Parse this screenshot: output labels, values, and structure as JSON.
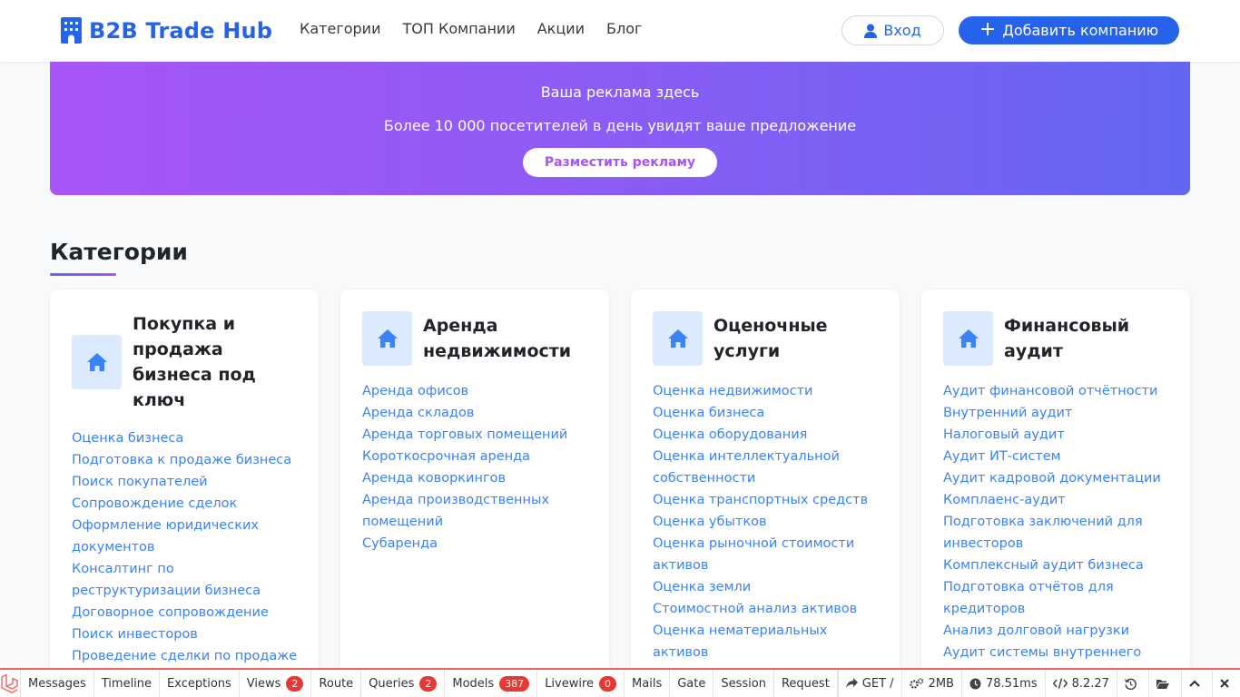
{
  "header": {
    "brand": "B2B Trade Hub",
    "nav": [
      "Категории",
      "ТОП Компании",
      "Акции",
      "Блог"
    ],
    "login_label": "Вход",
    "add_company_label": "Добавить компанию"
  },
  "ad": {
    "title": "Ваша реклама здесь",
    "subtitle": "Более 10 000 посетителей в день увидят ваше предложение",
    "button": "Разместить рекламу"
  },
  "categories_section": {
    "title": "Категории",
    "cards": [
      {
        "icon": "home-icon",
        "title": "Покупка и продажа бизнеса под ключ",
        "items": [
          "Оценка бизнеса",
          "Подготовка к продаже бизнеса",
          "Поиск покупателей",
          "Сопровождение сделок",
          "Оформление юридических документов",
          "Консалтинг по реструктуризации бизнеса",
          "Договорное сопровождение",
          "Поиск инвесторов",
          "Проведение сделки по продаже"
        ]
      },
      {
        "icon": "home-icon",
        "title": "Аренда недвижимости",
        "items": [
          "Аренда офисов",
          "Аренда складов",
          "Аренда торговых помещений",
          "Короткосрочная аренда",
          "Аренда коворкингов",
          "Аренда производственных помещений",
          "Субаренда"
        ]
      },
      {
        "icon": "home-icon",
        "title": "Оценочные услуги",
        "items": [
          "Оценка недвижимости",
          "Оценка бизнеса",
          "Оценка оборудования",
          "Оценка интеллектуальной собственности",
          "Оценка транспортных средств",
          "Оценка убытков",
          "Оценка рыночной стоимости активов",
          "Оценка земли",
          "Стоимостной анализ активов",
          "Оценка нематериальных активов"
        ]
      },
      {
        "icon": "home-icon",
        "title": "Финансовый аудит",
        "items": [
          "Аудит финансовой отчётности",
          "Внутренний аудит",
          "Налоговый аудит",
          "Аудит ИТ-систем",
          "Аудит кадровой документации",
          "Комплаенс-аудит",
          "Подготовка заключений для инвесторов",
          "Комплексный аудит бизнеса",
          "Подготовка отчётов для кредиторов",
          "Анализ долговой нагрузки",
          "Аудит системы внутреннего"
        ]
      }
    ]
  },
  "debugbar": {
    "tabs": [
      {
        "label": "Messages",
        "badge": ""
      },
      {
        "label": "Timeline",
        "badge": ""
      },
      {
        "label": "Exceptions",
        "badge": ""
      },
      {
        "label": "Views",
        "badge": "2"
      },
      {
        "label": "Route",
        "badge": ""
      },
      {
        "label": "Queries",
        "badge": "2"
      },
      {
        "label": "Models",
        "badge": "387"
      },
      {
        "label": "Livewire",
        "badge": "0"
      },
      {
        "label": "Mails",
        "badge": ""
      },
      {
        "label": "Gate",
        "badge": ""
      },
      {
        "label": "Session",
        "badge": ""
      },
      {
        "label": "Request",
        "badge": ""
      }
    ],
    "request": "GET /",
    "memory": "2MB",
    "time": "78.51ms",
    "php_version": "8.2.27"
  },
  "colors": {
    "brand": "#2563eb",
    "link": "#3b82f6",
    "ad_start": "#a855f7",
    "ad_end": "#6366f1",
    "badge": "#e53935"
  }
}
